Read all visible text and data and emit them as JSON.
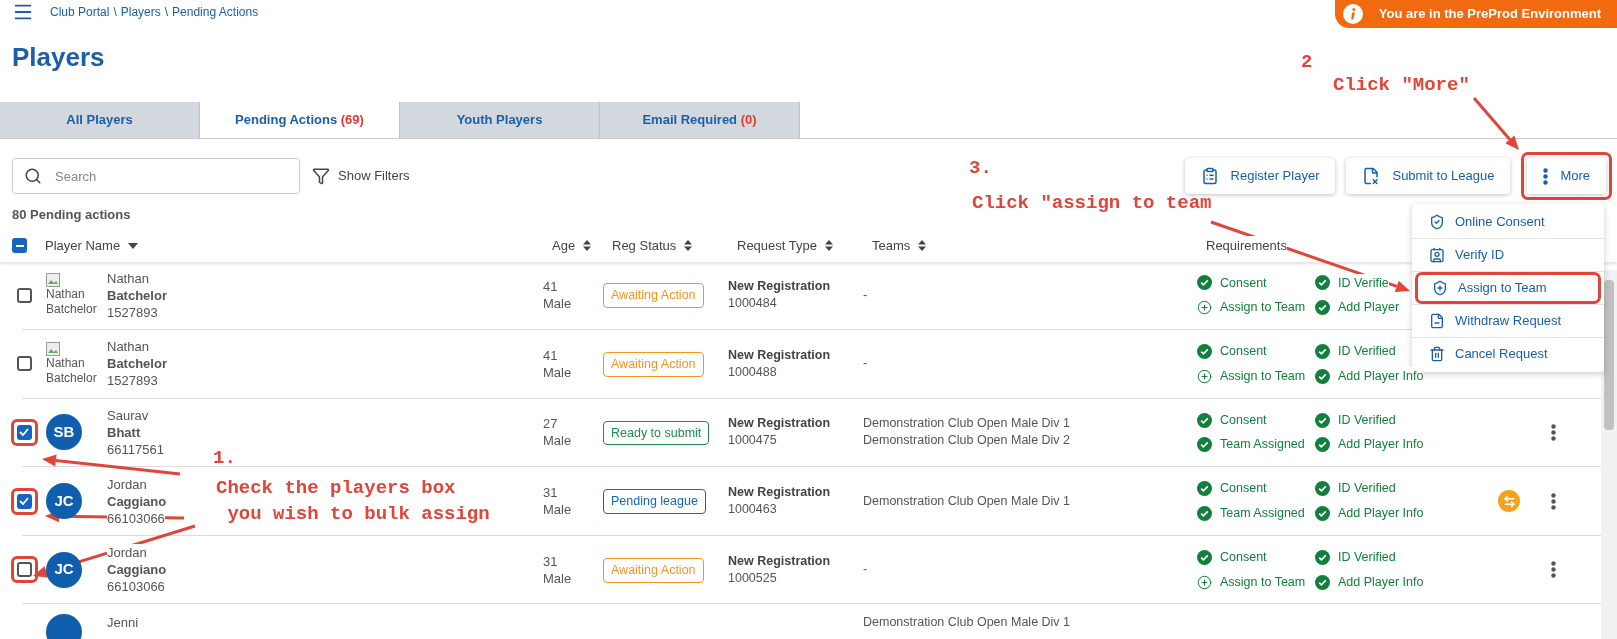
{
  "breadcrumb": {
    "items": [
      "Club Portal",
      "Players",
      "Pending Actions"
    ],
    "separator": "\\"
  },
  "environment_banner": {
    "text": "You are in the PreProd Environment"
  },
  "page_title": "Players",
  "tabs": [
    {
      "label": "All Players",
      "selected": false
    },
    {
      "label": "Pending Actions",
      "count": "(69)",
      "selected": true
    },
    {
      "label": "Youth Players",
      "selected": false
    },
    {
      "label": "Email Required",
      "count": "(0)",
      "selected": false
    }
  ],
  "toolbar": {
    "search": {
      "placeholder": "Search"
    },
    "filters_label": "Show Filters",
    "buttons": [
      {
        "label": "Register Player",
        "kind": "register",
        "highlighted": false
      },
      {
        "label": "Submit to League",
        "kind": "submit",
        "highlighted": false
      },
      {
        "label": "More",
        "kind": "more",
        "highlighted": true
      }
    ]
  },
  "summary": "80 Pending actions",
  "table": {
    "select_all_partial": true,
    "columns": [
      {
        "label": "Player Name",
        "sortable": true,
        "sorted_descending": true
      },
      {
        "label": "Age",
        "sortable": true,
        "sorted_descending": false
      },
      {
        "label": "Reg Status",
        "sortable": true,
        "sorted_descending": false
      },
      {
        "label": "Request Type",
        "sortable": true,
        "sorted_descending": false
      },
      {
        "label": "Teams",
        "sortable": true,
        "sorted_descending": false
      },
      {
        "label": "Requirements",
        "sortable": false
      }
    ],
    "rows": [
      {
        "checked": false,
        "highlighted": false,
        "avatar": {
          "kind": "broken-image",
          "alt": "Nathan Batchelor"
        },
        "first_name": "Nathan",
        "last_name": "Batchelor",
        "player_id": "1527893",
        "age": "41",
        "gender": "Male",
        "status": {
          "label": "Awaiting Action",
          "color": "#f7931e"
        },
        "request_type": "New Registration",
        "request_id": "1000484",
        "teams": [
          "-"
        ],
        "requirements": [
          {
            "label": "Consent",
            "done": true
          },
          {
            "label": "ID Verifie",
            "done": true
          },
          {
            "label": "Assign to Team",
            "done": false
          },
          {
            "label": "Add Player",
            "done": true
          }
        ],
        "sync": false,
        "kebab": false
      },
      {
        "checked": false,
        "highlighted": false,
        "avatar": {
          "kind": "broken-image",
          "alt": "Nathan Batchelor"
        },
        "first_name": "Nathan",
        "last_name": "Batchelor",
        "player_id": "1527893",
        "age": "41",
        "gender": "Male",
        "status": {
          "label": "Awaiting Action",
          "color": "#f7931e"
        },
        "request_type": "New Registration",
        "request_id": "1000488",
        "teams": [
          "-"
        ],
        "requirements": [
          {
            "label": "Consent",
            "done": true
          },
          {
            "label": "ID Verified",
            "done": true
          },
          {
            "label": "Assign to Team",
            "done": false
          },
          {
            "label": "Add Player Info",
            "done": true
          }
        ],
        "sync": false,
        "kebab": false
      },
      {
        "checked": true,
        "highlighted": true,
        "avatar": {
          "kind": "initials",
          "text": "SB"
        },
        "first_name": "Saurav",
        "last_name": "Bhatt",
        "player_id": "66117561",
        "age": "27",
        "gender": "Male",
        "status": {
          "label": "Ready to submit",
          "color": "#1e8a4c"
        },
        "request_type": "New Registration",
        "request_id": "1000475",
        "teams": [
          "Demonstration Club Open Male Div 1",
          "Demonstration Club Open Male Div 2"
        ],
        "requirements": [
          {
            "label": "Consent",
            "done": true
          },
          {
            "label": "ID Verified",
            "done": true
          },
          {
            "label": "Team Assigned",
            "done": true
          },
          {
            "label": "Add Player Info",
            "done": true
          }
        ],
        "sync": false,
        "kebab": true
      },
      {
        "checked": true,
        "highlighted": true,
        "avatar": {
          "kind": "initials",
          "text": "JC"
        },
        "first_name": "Jordan",
        "last_name": "Caggiano",
        "player_id": "66103066",
        "age": "31",
        "gender": "Male",
        "status": {
          "label": "Pending league",
          "color": "#1565c0"
        },
        "request_type": "New Registration",
        "request_id": "1000463",
        "teams": [
          "Demonstration Club Open Male Div 1"
        ],
        "requirements": [
          {
            "label": "Consent",
            "done": true
          },
          {
            "label": "ID Verified",
            "done": true
          },
          {
            "label": "Team Assigned",
            "done": true
          },
          {
            "label": "Add Player Info",
            "done": true
          }
        ],
        "sync": true,
        "kebab": true
      },
      {
        "checked": false,
        "highlighted": true,
        "avatar": {
          "kind": "initials",
          "text": "JC"
        },
        "first_name": "Jordan",
        "last_name": "Caggiano",
        "player_id": "66103066",
        "age": "31",
        "gender": "Male",
        "status": {
          "label": "Awaiting Action",
          "color": "#f7931e"
        },
        "request_type": "New Registration",
        "request_id": "1000525",
        "teams": [
          "-"
        ],
        "requirements": [
          {
            "label": "Consent",
            "done": true
          },
          {
            "label": "ID Verified",
            "done": true
          },
          {
            "label": "Assign to Team",
            "done": false
          },
          {
            "label": "Add Player Info",
            "done": true
          }
        ],
        "sync": false,
        "kebab": true
      },
      {
        "avatar": {
          "kind": "blank"
        },
        "first_name": "Jenni",
        "teams": [
          "Demonstration Club Open Male Div 1"
        ]
      }
    ]
  },
  "more_menu": [
    {
      "label": "Online Consent",
      "kind": "consent",
      "highlighted": false
    },
    {
      "label": "Verify ID",
      "kind": "verify",
      "highlighted": false
    },
    {
      "label": "Assign to Team",
      "kind": "assign",
      "highlighted": true
    },
    {
      "label": "Withdraw Request",
      "kind": "withdraw",
      "highlighted": false
    },
    {
      "label": "Cancel Request",
      "kind": "cancel",
      "highlighted": false
    }
  ],
  "annotations": [
    "1.",
    "Check the players box",
    " you wish to bulk assign",
    "2",
    "Click \"More\"",
    "3.",
    "Click \"assign to team"
  ]
}
